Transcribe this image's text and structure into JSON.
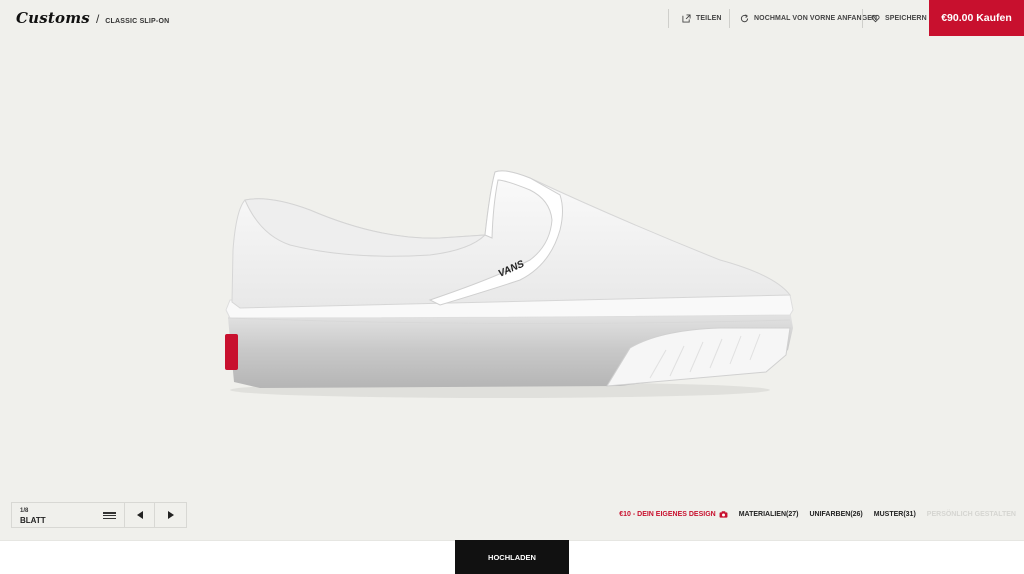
{
  "header": {
    "logo": "Customs",
    "separator": "/",
    "model": "CLASSIC SLIP-ON",
    "share_label": "TEILEN",
    "restart_label": "NOCHMAL VON VORNE ANFANGEN",
    "save_label": "SPEICHERN",
    "buy_label": "€90.00 Kaufen"
  },
  "shoe": {
    "brand_text": "VANS",
    "upper_color": "#ffffff",
    "heel_tab_color": "#c8102e"
  },
  "pager": {
    "count": "1/8",
    "label": "BLATT"
  },
  "tabs": [
    {
      "label": "€10 - DEIN EIGENES DESIGN"
    },
    {
      "label": "MATERIALIEN(27)"
    },
    {
      "label": "UNIFARBEN(26)"
    },
    {
      "label": "MUSTER(31)"
    },
    {
      "label": "PERSÖNLICH GESTALTEN"
    }
  ],
  "upload": {
    "label": "HOCHLADEN"
  },
  "colors": {
    "accent": "#c8102e",
    "background": "#f0f0ec",
    "dark": "#111111"
  }
}
